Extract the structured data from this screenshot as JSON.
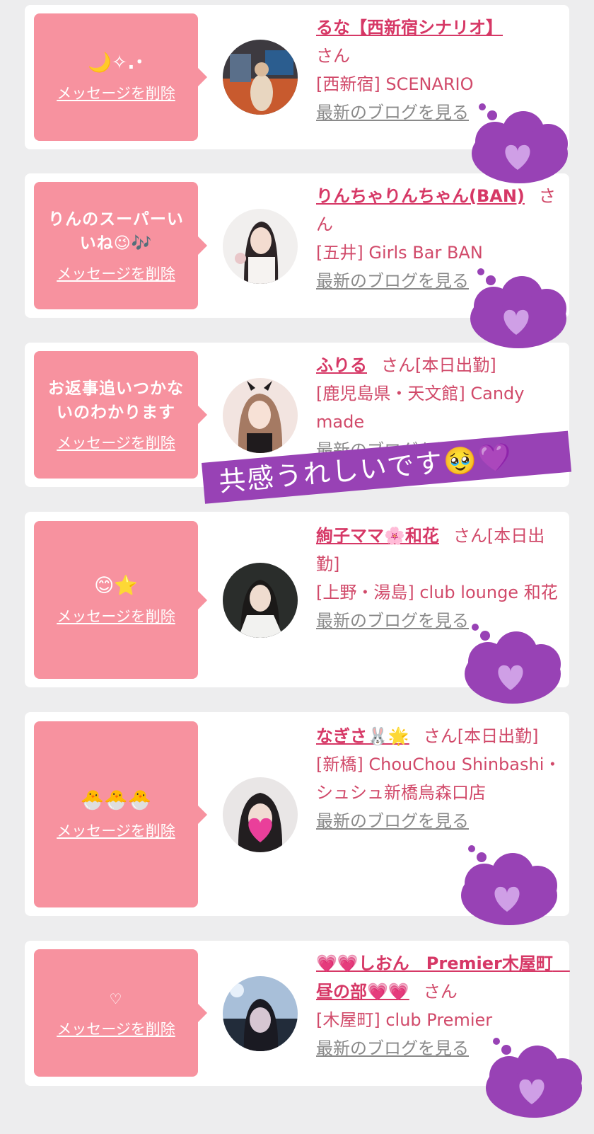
{
  "entries": [
    {
      "message": "🌙✧.･",
      "delete_label": "メッセージを削除",
      "name": "るな【西新宿シナリオ】",
      "san": "さん",
      "store": "[西新宿] SCENARIO",
      "blog_label": "最新のブログを見る"
    },
    {
      "message": "りんのスーパーいいね😉🎶",
      "delete_label": "メッセージを削除",
      "name": "りんちゃりんちゃん(BAN)",
      "san": "さん",
      "store": "[五井] Girls Bar BAN",
      "blog_label": "最新のブログを見る"
    },
    {
      "message": "お返事追いつかないのわかります",
      "delete_label": "メッセージを削除",
      "name": "ふりる",
      "san": "さん[本日出勤]",
      "store": "[鹿児島県・天文館] Candy made",
      "blog_label": "最新のブログを見る"
    },
    {
      "message": "😊⭐",
      "delete_label": "メッセージを削除",
      "name": "絢子ママ🌸和花",
      "san": "さん[本日出勤]",
      "store": "[上野・湯島] club lounge 和花",
      "blog_label": "最新のブログを見る"
    },
    {
      "message": "🐣🐣🐣",
      "delete_label": "メッセージを削除",
      "name": "なぎさ🐰🌟",
      "san": "さん[本日出勤]",
      "store": "[新橋] ChouChou Shinbashi・シュシュ新橋烏森口店",
      "blog_label": "最新のブログを見る"
    },
    {
      "message": "♡",
      "delete_label": "メッセージを削除",
      "name": "💗💗しおん　Premier木屋町　昼の部💗💗",
      "san": "さん",
      "store": "[木屋町] club Premier",
      "blog_label": "最新のブログを見る"
    }
  ],
  "overlay_text": "共感うれしいです🥹💜",
  "colors": {
    "background": "#ededee",
    "bubble": "#f7929f",
    "name": "#d63866",
    "store": "#d14a6a",
    "blog": "#8a8a8a",
    "sticker_purple": "#9842b5"
  },
  "icons": [
    "purple-heart-cloud-sticker",
    "avatar-photo"
  ]
}
